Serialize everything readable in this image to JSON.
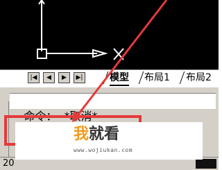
{
  "viewport": {
    "axis_label": "X",
    "background": "#000000",
    "pointer_color": "#e53a3a"
  },
  "layout_tabs": {
    "nav_buttons": [
      "first-icon",
      "prev-icon",
      "next-icon",
      "last-icon"
    ],
    "tabs": [
      {
        "label": "模型",
        "active": true
      },
      {
        "label": "布局1",
        "active": false
      },
      {
        "label": "布局2",
        "active": false
      }
    ]
  },
  "command": {
    "text": "命令：  *取消*"
  },
  "watermark": {
    "brand_a": "我",
    "brand_b": "就看",
    "url": "www.wojiukan.com"
  },
  "status": {
    "coord_prefix": "20"
  },
  "colors": {
    "highlight": "#e53a3a",
    "brand_orange": "#f39a1d",
    "panel": "#d4d0c8"
  }
}
